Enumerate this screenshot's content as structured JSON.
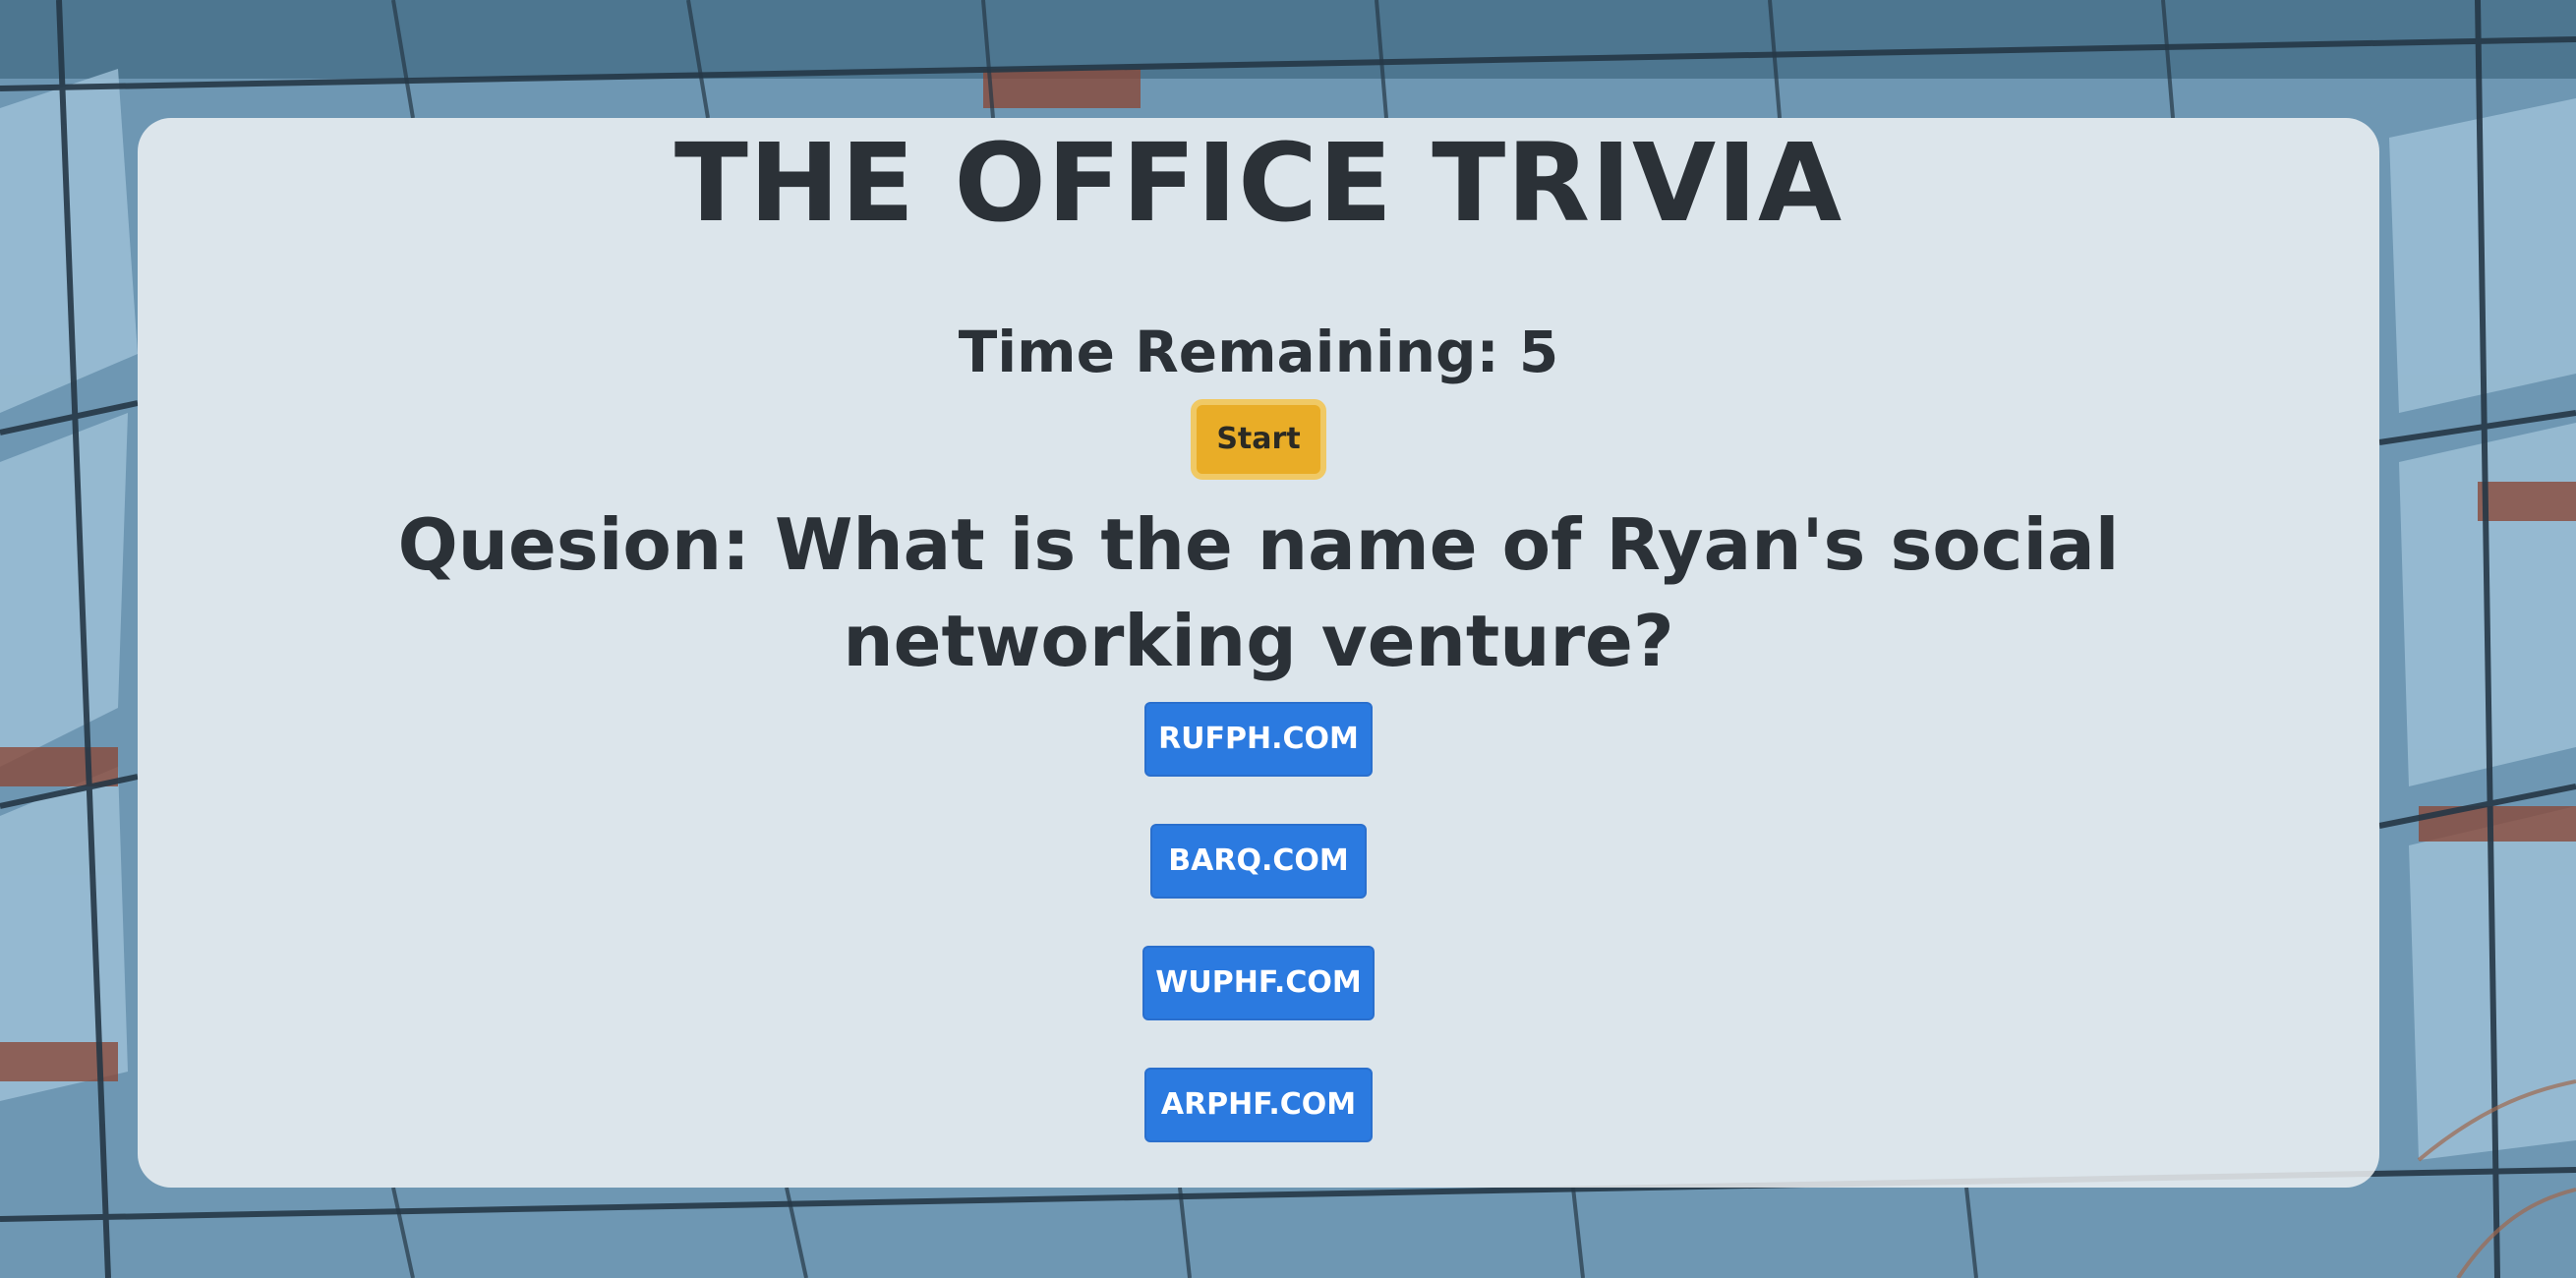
{
  "app": {
    "title": "THE OFFICE TRIVIA"
  },
  "timer": {
    "text": "Time Remaining: 5"
  },
  "controls": {
    "start_label": "Start"
  },
  "question": {
    "text": "Quesion: What is the name of Ryan's social networking venture?"
  },
  "answers": [
    "RUFPH.COM",
    "BARQ.COM",
    "WUPHF.COM",
    "ARPHF.COM"
  ],
  "colors": {
    "start_button": "#e9ad27",
    "answer_button": "#2b7ae0",
    "text": "#2b3137"
  }
}
